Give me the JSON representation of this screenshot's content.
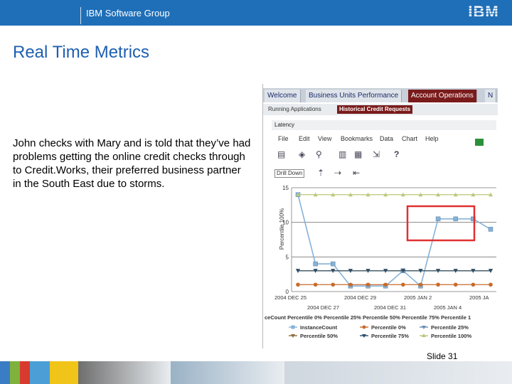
{
  "header": {
    "group_name": "IBM Software Group",
    "logo_text": "IBM"
  },
  "slide": {
    "title": "Real Time Metrics",
    "body": "John checks with Mary and is told that they’ve had problems getting the online credit checks through to Credit.Works, their preferred business partner in the South East due to storms.",
    "slide_number": "Slide 31"
  },
  "app": {
    "tabs": [
      "Welcome",
      "Business Units Performance",
      "Account Operations",
      "N"
    ],
    "active_tab": "Account Operations",
    "subtabs": [
      "Running Applications",
      "Historical Credit Requests"
    ],
    "active_subtab": "Historical Credit Requests",
    "panel_title": "Latency",
    "menu": [
      "File",
      "Edit",
      "View",
      "Bookmarks",
      "Data",
      "Chart",
      "Help"
    ],
    "drill_label": "Drill Down"
  },
  "chart_data": {
    "type": "line",
    "ylabel": "Percentile 100%",
    "ylim": [
      0,
      15
    ],
    "yticks": [
      0,
      5,
      10,
      15
    ],
    "xticks_top": [
      "2004 DEC 25",
      "2004 DEC 29",
      "2005 JAN 2",
      "2005 JA"
    ],
    "xticks_bottom": [
      "2004 DEC 27",
      "2004 DEC 31",
      "2005 JAN 4"
    ],
    "x_caption": "ceCount Percentile 0% Percentile 25% Percentile 50% Percentile 75% Percentile 1",
    "series": [
      {
        "name": "InstanceCount",
        "color": "#86b2d8",
        "marker": "square",
        "values": [
          14,
          4,
          4,
          0.8,
          0.8,
          0.8,
          3,
          0.8,
          10.5,
          10.5,
          10.5,
          9
        ]
      },
      {
        "name": "Percentile 0%",
        "color": "#c96b2c",
        "marker": "circle",
        "values": [
          1,
          1,
          1,
          1,
          1,
          1,
          1,
          1,
          1,
          1,
          1,
          1
        ]
      },
      {
        "name": "Percentile 25%",
        "color": "#6a8fb5",
        "marker": "triangle-down",
        "values": [
          3,
          3,
          3,
          3,
          3,
          3,
          3,
          3,
          3,
          3,
          3,
          3
        ]
      },
      {
        "name": "Percentile 50%",
        "color": "#8c6d3a",
        "marker": "triangle-down",
        "values": [
          3,
          3,
          3,
          3,
          3,
          3,
          3,
          3,
          3,
          3,
          3,
          3
        ]
      },
      {
        "name": "Percentile 75%",
        "color": "#2d4f6a",
        "marker": "triangle-down",
        "values": [
          3,
          3,
          3,
          3,
          3,
          3,
          3,
          3,
          3,
          3,
          3,
          3
        ]
      },
      {
        "name": "Percentile 100%",
        "color": "#b9c97a",
        "marker": "triangle-up",
        "values": [
          14,
          14,
          14,
          14,
          14,
          14,
          14,
          14,
          14,
          14,
          14,
          14
        ]
      }
    ],
    "highlight_color": "#e03030",
    "grid": true
  },
  "footer": {
    "strip_colors": [
      "#3b7dc4",
      "#7fb23c",
      "#d83a2d",
      "#4c9fd6",
      "#f0c419",
      "#6e6e6e",
      "#9ab2c6",
      "#cfd7df"
    ]
  }
}
